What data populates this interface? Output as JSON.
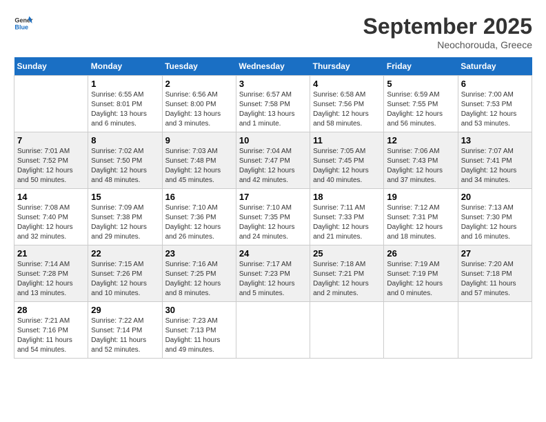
{
  "header": {
    "logo_line1": "General",
    "logo_line2": "Blue",
    "month": "September 2025",
    "location": "Neochorouda, Greece"
  },
  "days_of_week": [
    "Sunday",
    "Monday",
    "Tuesday",
    "Wednesday",
    "Thursday",
    "Friday",
    "Saturday"
  ],
  "weeks": [
    [
      {
        "num": "",
        "empty": true
      },
      {
        "num": "1",
        "sunrise": "6:55 AM",
        "sunset": "8:01 PM",
        "daylight": "13 hours and 6 minutes."
      },
      {
        "num": "2",
        "sunrise": "6:56 AM",
        "sunset": "8:00 PM",
        "daylight": "13 hours and 3 minutes."
      },
      {
        "num": "3",
        "sunrise": "6:57 AM",
        "sunset": "7:58 PM",
        "daylight": "13 hours and 1 minute."
      },
      {
        "num": "4",
        "sunrise": "6:58 AM",
        "sunset": "7:56 PM",
        "daylight": "12 hours and 58 minutes."
      },
      {
        "num": "5",
        "sunrise": "6:59 AM",
        "sunset": "7:55 PM",
        "daylight": "12 hours and 56 minutes."
      },
      {
        "num": "6",
        "sunrise": "7:00 AM",
        "sunset": "7:53 PM",
        "daylight": "12 hours and 53 minutes."
      }
    ],
    [
      {
        "num": "7",
        "sunrise": "7:01 AM",
        "sunset": "7:52 PM",
        "daylight": "12 hours and 50 minutes."
      },
      {
        "num": "8",
        "sunrise": "7:02 AM",
        "sunset": "7:50 PM",
        "daylight": "12 hours and 48 minutes."
      },
      {
        "num": "9",
        "sunrise": "7:03 AM",
        "sunset": "7:48 PM",
        "daylight": "12 hours and 45 minutes."
      },
      {
        "num": "10",
        "sunrise": "7:04 AM",
        "sunset": "7:47 PM",
        "daylight": "12 hours and 42 minutes."
      },
      {
        "num": "11",
        "sunrise": "7:05 AM",
        "sunset": "7:45 PM",
        "daylight": "12 hours and 40 minutes."
      },
      {
        "num": "12",
        "sunrise": "7:06 AM",
        "sunset": "7:43 PM",
        "daylight": "12 hours and 37 minutes."
      },
      {
        "num": "13",
        "sunrise": "7:07 AM",
        "sunset": "7:41 PM",
        "daylight": "12 hours and 34 minutes."
      }
    ],
    [
      {
        "num": "14",
        "sunrise": "7:08 AM",
        "sunset": "7:40 PM",
        "daylight": "12 hours and 32 minutes."
      },
      {
        "num": "15",
        "sunrise": "7:09 AM",
        "sunset": "7:38 PM",
        "daylight": "12 hours and 29 minutes."
      },
      {
        "num": "16",
        "sunrise": "7:10 AM",
        "sunset": "7:36 PM",
        "daylight": "12 hours and 26 minutes."
      },
      {
        "num": "17",
        "sunrise": "7:10 AM",
        "sunset": "7:35 PM",
        "daylight": "12 hours and 24 minutes."
      },
      {
        "num": "18",
        "sunrise": "7:11 AM",
        "sunset": "7:33 PM",
        "daylight": "12 hours and 21 minutes."
      },
      {
        "num": "19",
        "sunrise": "7:12 AM",
        "sunset": "7:31 PM",
        "daylight": "12 hours and 18 minutes."
      },
      {
        "num": "20",
        "sunrise": "7:13 AM",
        "sunset": "7:30 PM",
        "daylight": "12 hours and 16 minutes."
      }
    ],
    [
      {
        "num": "21",
        "sunrise": "7:14 AM",
        "sunset": "7:28 PM",
        "daylight": "12 hours and 13 minutes."
      },
      {
        "num": "22",
        "sunrise": "7:15 AM",
        "sunset": "7:26 PM",
        "daylight": "12 hours and 10 minutes."
      },
      {
        "num": "23",
        "sunrise": "7:16 AM",
        "sunset": "7:25 PM",
        "daylight": "12 hours and 8 minutes."
      },
      {
        "num": "24",
        "sunrise": "7:17 AM",
        "sunset": "7:23 PM",
        "daylight": "12 hours and 5 minutes."
      },
      {
        "num": "25",
        "sunrise": "7:18 AM",
        "sunset": "7:21 PM",
        "daylight": "12 hours and 2 minutes."
      },
      {
        "num": "26",
        "sunrise": "7:19 AM",
        "sunset": "7:19 PM",
        "daylight": "12 hours and 0 minutes."
      },
      {
        "num": "27",
        "sunrise": "7:20 AM",
        "sunset": "7:18 PM",
        "daylight": "11 hours and 57 minutes."
      }
    ],
    [
      {
        "num": "28",
        "sunrise": "7:21 AM",
        "sunset": "7:16 PM",
        "daylight": "11 hours and 54 minutes."
      },
      {
        "num": "29",
        "sunrise": "7:22 AM",
        "sunset": "7:14 PM",
        "daylight": "11 hours and 52 minutes."
      },
      {
        "num": "30",
        "sunrise": "7:23 AM",
        "sunset": "7:13 PM",
        "daylight": "11 hours and 49 minutes."
      },
      {
        "num": "",
        "empty": true
      },
      {
        "num": "",
        "empty": true
      },
      {
        "num": "",
        "empty": true
      },
      {
        "num": "",
        "empty": true
      }
    ]
  ],
  "labels": {
    "sunrise": "Sunrise:",
    "sunset": "Sunset:",
    "daylight": "Daylight:"
  }
}
